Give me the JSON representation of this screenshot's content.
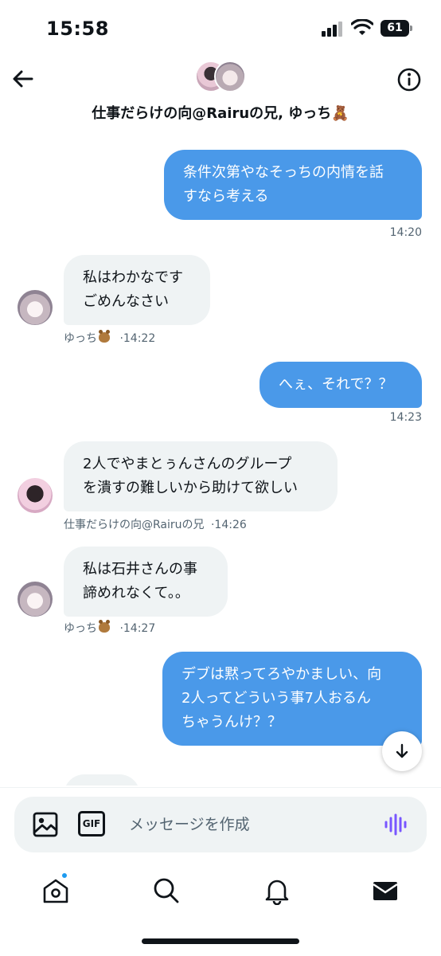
{
  "status_bar": {
    "time": "15:58",
    "battery": "61"
  },
  "header": {
    "title": "仕事だらけの向@Rairuの兄, ゆっち🧸",
    "back_icon": "arrow-left-icon",
    "info_icon": "info-icon"
  },
  "messages": [
    {
      "direction": "out",
      "text": "条件次第やなそっちの内情を話\nすなら考える",
      "time": "14:20"
    },
    {
      "direction": "in",
      "sender": "ゆっち",
      "text": "私はわかなです\nごめんなさい",
      "time": "·14:22"
    },
    {
      "direction": "out",
      "text": "へぇ、それで？？",
      "time": "14:23"
    },
    {
      "direction": "in",
      "sender": "仕事だらけの向@Rairuの兄",
      "text": "2人でやまとぅんさんのグループ\nを潰すの難しいから助けて欲しい",
      "time": "·14:26"
    },
    {
      "direction": "in",
      "sender": "ゆっち",
      "text": "私は石井さんの事\n諦めれなくて。。",
      "time": "·14:27"
    },
    {
      "direction": "out",
      "text": "デブは黙ってろやかましい、向\n2人ってどういう事7人おるん\nちゃうんけ？？",
      "time": ""
    }
  ],
  "composer": {
    "placeholder": "メッセージを作成",
    "gif_label": "GIF"
  },
  "nav": {
    "items": [
      "home-icon",
      "search-icon",
      "bell-icon",
      "mail-icon"
    ]
  },
  "colors": {
    "outgoing_bubble": "#4a99e9",
    "incoming_bubble": "#eff3f4",
    "accent": "#1d9bf0",
    "voice": "#7856ff"
  }
}
